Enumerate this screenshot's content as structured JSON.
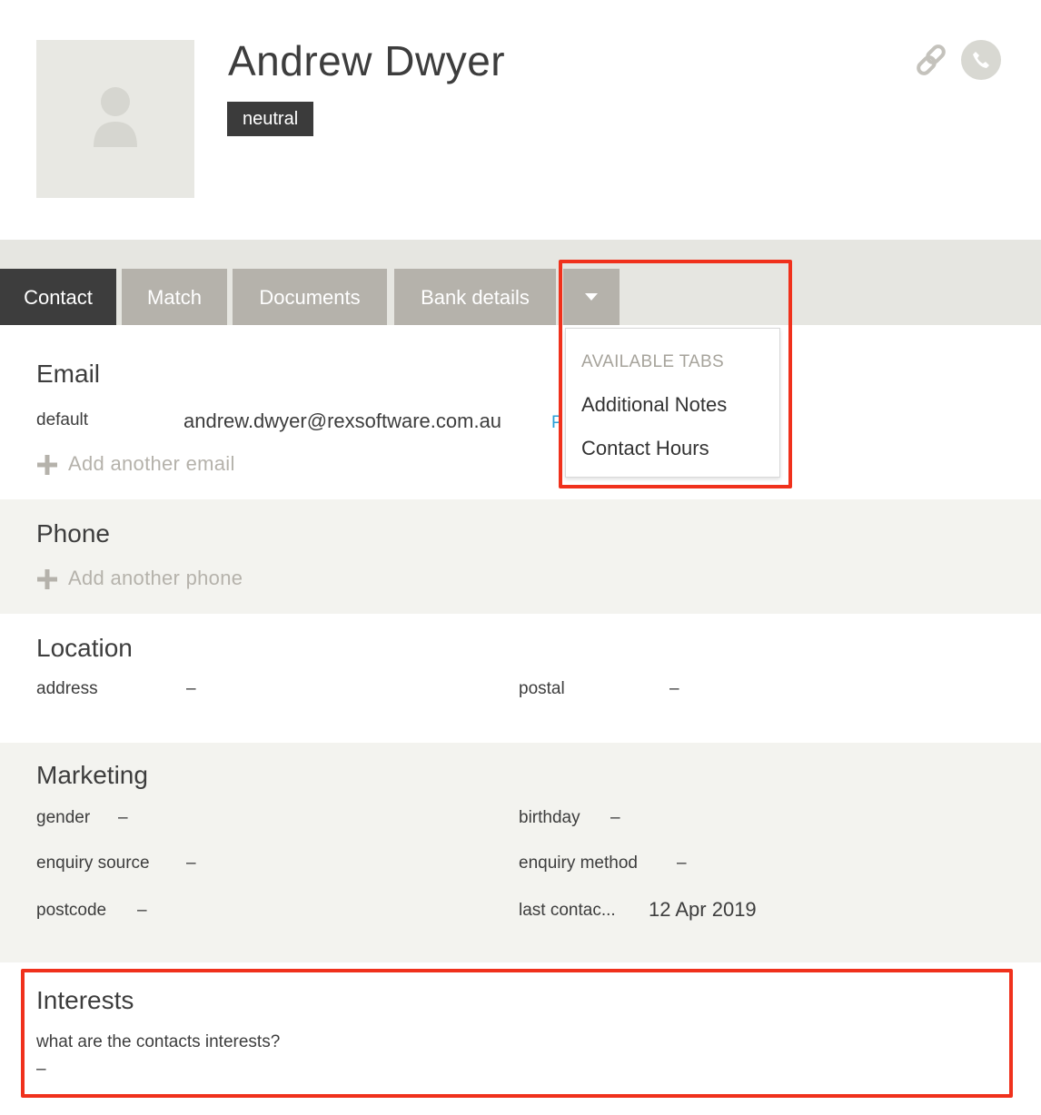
{
  "contact": {
    "name": "Andrew Dwyer",
    "badge": "neutral"
  },
  "header_icons": [
    "link-icon",
    "phone-icon"
  ],
  "tabs": [
    {
      "label": "Contact",
      "active": true
    },
    {
      "label": "Match",
      "active": false
    },
    {
      "label": "Documents",
      "active": false
    },
    {
      "label": "Bank details",
      "active": false
    }
  ],
  "dropdown": {
    "header": "AVAILABLE TABS",
    "items": [
      "Additional Notes",
      "Contact Hours"
    ]
  },
  "email": {
    "title": "Email",
    "label": "default",
    "value": "andrew.dwyer@rexsoftware.com.au",
    "extra": "P",
    "add_label": "Add another email"
  },
  "phone": {
    "title": "Phone",
    "add_label": "Add another phone"
  },
  "location": {
    "title": "Location",
    "address_label": "address",
    "address_value": "–",
    "postal_label": "postal",
    "postal_value": "–"
  },
  "marketing": {
    "title": "Marketing",
    "gender_label": "gender",
    "gender_value": "–",
    "birthday_label": "birthday",
    "birthday_value": "–",
    "enquiry_source_label": "enquiry source",
    "enquiry_source_value": "–",
    "enquiry_method_label": "enquiry method",
    "enquiry_method_value": "–",
    "postcode_label": "postcode",
    "postcode_value": "–",
    "last_contact_label": "last contac...",
    "last_contact_value": "12 Apr 2019"
  },
  "interests": {
    "title": "Interests",
    "question": "what are the contacts interests?",
    "value": "–"
  },
  "colors": {
    "highlight": "#f0311c",
    "tab_active": "#3d3d3d",
    "tab_inactive": "#b5b2ab",
    "link_blue": "#2a9fd6"
  }
}
